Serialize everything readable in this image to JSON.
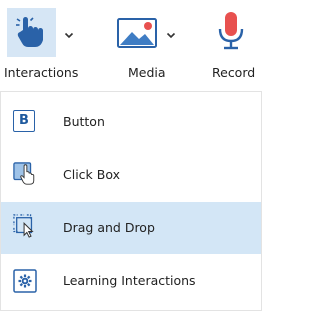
{
  "toolbar": {
    "interactions_label": "Interactions",
    "media_label": "Media",
    "record_label": "Record"
  },
  "menu": {
    "items": [
      {
        "label": "Button",
        "icon": "button-b-icon",
        "highlighted": false
      },
      {
        "label": "Click Box",
        "icon": "click-box-icon",
        "highlighted": false
      },
      {
        "label": "Drag and Drop",
        "icon": "drag-drop-icon",
        "highlighted": true
      },
      {
        "label": "Learning Interactions",
        "icon": "learning-interactions-icon",
        "highlighted": false
      }
    ],
    "button_icon_letter": "B"
  },
  "colors": {
    "accent_blue": "#2a62a8",
    "active_tile": "#d6e6f5",
    "highlight_row": "#d3e6f6",
    "record_red": "#e8514f"
  }
}
